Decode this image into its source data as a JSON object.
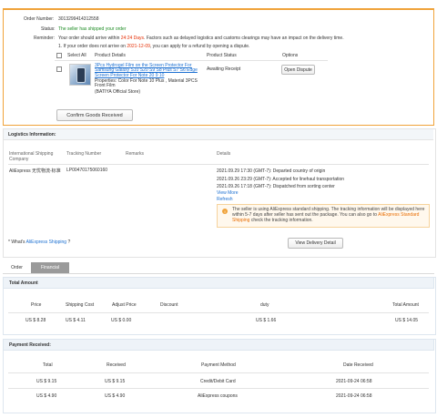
{
  "order": {
    "number_label": "Order Number:",
    "number_value": "3013299414312558",
    "status_label": "Status:",
    "status_value": "The seller has shipped your order",
    "reminder_label": "Reminder:",
    "reminder_pre": "Your order should arrive within",
    "reminder_days": "24:24 Days",
    "reminder_post": ". Factors such as delayed logistics and customs clearings may have an impact on the delivery time.",
    "reminder2_pre": "1. If your order does not arrive on",
    "reminder2_date": "2021-12-09",
    "reminder2_post": ", you can apply for a refund by opening a dispute."
  },
  "products_table": {
    "select_all": "Select All",
    "col_details": "Product Details",
    "col_status": "Product Status",
    "col_options": "Options",
    "item": {
      "title": "3Pcs Hydrogel Film on the Screen Protector For Samsung Galaxy S10 S20 S9 S8 Plus S7 S6 Edge Screen Protector For Note 20 9 10",
      "properties": "Properties: Color For Note 10 Plus , Material 3PCS Front Film",
      "store": "(BATIYA Official Store)",
      "status": "Awaiting Receipt",
      "option_button": "Open Dispute"
    },
    "confirm_button": "Confirm Goods Received"
  },
  "logistics": {
    "title": "Logistics Information:",
    "col_company": "International Shipping Company",
    "col_tracking": "Tracking Number",
    "col_remarks": "Remarks",
    "col_details": "Details",
    "company": "AliExpress 无忧物流-标准",
    "tracking": "LP00470175060160",
    "events": [
      "2021.09.29 17:30 (GMT-7): Departed country of origin",
      "2021.09.26 23:29 (GMT-7): Accepted for linehaul transportation",
      "2021.09.26 17:18 (GMT-7): Dispatched from sorting center"
    ],
    "view_more": "View More",
    "refresh": "Refresh",
    "notice_text": "The seller is using AliExpress standard shipping. The tracking information will be displayed here within 5-7 days after seller has sent out the package. You can also go to",
    "notice_link": "AliExpress Standard Shipping",
    "notice_end": "check the tracking information.",
    "whats_pre": "* What's",
    "whats_link": "AliExpress Shipping",
    "whats_post": "?",
    "view_delivery_button": "View Delivery Detail"
  },
  "tabs": [
    {
      "label": "Order"
    },
    {
      "label": "Financial"
    }
  ],
  "total_amount": {
    "title": "Total Amount",
    "headers": [
      "Price",
      "Shipping Cost",
      "Adjust Price",
      "Discount",
      "duty",
      "Total Amount"
    ],
    "row": [
      "US $ 8.28",
      "US $ 4.11",
      "US $ 0.00",
      "",
      "US $ 1.66",
      "US $ 14.05"
    ]
  },
  "payment_received": {
    "title": "Payment Received:",
    "headers": [
      "Total",
      "Received",
      "Payment Method",
      "Date Received"
    ],
    "rows": [
      [
        "US $ 9.15",
        "US $ 9.15",
        "Credit/Debit Card",
        "2021-09-24 06:58"
      ],
      [
        "US $ 4.90",
        "US $ 4.90",
        "AliExpress coupons",
        "2021-09-24 06:58"
      ]
    ]
  },
  "colors": {
    "accent_orange": "#f0a33a",
    "link_blue": "#1b6fd1",
    "status_green": "#1d8c23",
    "alert_red": "#e62e04",
    "active_tab": "#9a9a9a"
  }
}
